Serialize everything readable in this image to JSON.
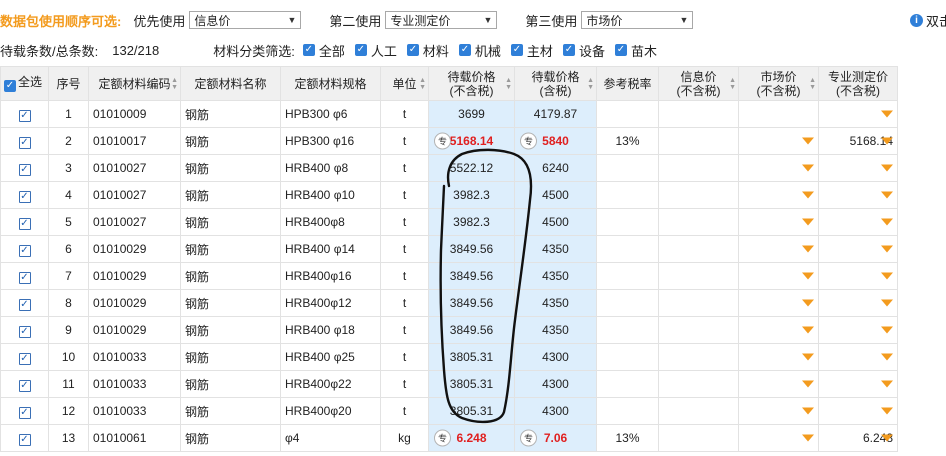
{
  "toolbar": {
    "title": "数据包使用顺序可选:",
    "first_label": "优先使用",
    "first_value": "信息价",
    "second_label": "第二使用",
    "second_value": "专业测定价",
    "third_label": "第三使用",
    "third_value": "市场价",
    "dual_label": "双击"
  },
  "filter": {
    "count_label": "待载条数/总条数:",
    "count_value": "132/218",
    "category_label": "材料分类筛选:",
    "items": [
      "全部",
      "人工",
      "材料",
      "机械",
      "主材",
      "设备",
      "苗木"
    ]
  },
  "columns": [
    {
      "l1": "全选",
      "l2": ""
    },
    {
      "l1": "序号",
      "l2": ""
    },
    {
      "l1": "定额材料编码",
      "l2": ""
    },
    {
      "l1": "定额材料名称",
      "l2": ""
    },
    {
      "l1": "定额材料规格",
      "l2": ""
    },
    {
      "l1": "单位",
      "l2": ""
    },
    {
      "l1": "待载价格",
      "l2": "(不含税)"
    },
    {
      "l1": "待载价格",
      "l2": "(含税)"
    },
    {
      "l1": "参考税率",
      "l2": ""
    },
    {
      "l1": "信息价",
      "l2": "(不含税)"
    },
    {
      "l1": "市场价",
      "l2": "(不含税)"
    },
    {
      "l1": "专业测定价",
      "l2": "(不含税)"
    }
  ],
  "tag_label": "专",
  "rows": [
    {
      "no": "1",
      "code": "01010009",
      "name": "钢筋",
      "spec": "HPB300 φ6",
      "unit": "t",
      "p1": "3699",
      "p2": "4179.87",
      "tax": "",
      "info": "",
      "market": "",
      "pro": "",
      "tagged": false,
      "hl": false,
      "info_dd": false,
      "market_dd": false
    },
    {
      "no": "2",
      "code": "01010017",
      "name": "钢筋",
      "spec": "HPB300 φ16",
      "unit": "t",
      "p1": "5168.14",
      "p2": "5840",
      "tax": "13%",
      "info": "",
      "market": "",
      "pro": "5168.14",
      "tagged": true,
      "hl": true,
      "info_dd": false,
      "market_dd": true
    },
    {
      "no": "3",
      "code": "01010027",
      "name": "钢筋",
      "spec": "HRB400 φ8",
      "unit": "t",
      "p1": "5522.12",
      "p2": "6240",
      "tax": "",
      "info": "",
      "market": "",
      "pro": "",
      "tagged": false,
      "hl": false,
      "info_dd": false,
      "market_dd": true
    },
    {
      "no": "4",
      "code": "01010027",
      "name": "钢筋",
      "spec": "HRB400 φ10",
      "unit": "t",
      "p1": "3982.3",
      "p2": "4500",
      "tax": "",
      "info": "",
      "market": "",
      "pro": "",
      "tagged": false,
      "hl": false,
      "info_dd": false,
      "market_dd": true
    },
    {
      "no": "5",
      "code": "01010027",
      "name": "钢筋",
      "spec": "HRB400φ8",
      "unit": "t",
      "p1": "3982.3",
      "p2": "4500",
      "tax": "",
      "info": "",
      "market": "",
      "pro": "",
      "tagged": false,
      "hl": false,
      "info_dd": false,
      "market_dd": true
    },
    {
      "no": "6",
      "code": "01010029",
      "name": "钢筋",
      "spec": "HRB400 φ14",
      "unit": "t",
      "p1": "3849.56",
      "p2": "4350",
      "tax": "",
      "info": "",
      "market": "",
      "pro": "",
      "tagged": false,
      "hl": false,
      "info_dd": false,
      "market_dd": true
    },
    {
      "no": "7",
      "code": "01010029",
      "name": "钢筋",
      "spec": "HRB400φ16",
      "unit": "t",
      "p1": "3849.56",
      "p2": "4350",
      "tax": "",
      "info": "",
      "market": "",
      "pro": "",
      "tagged": false,
      "hl": false,
      "info_dd": false,
      "market_dd": true
    },
    {
      "no": "8",
      "code": "01010029",
      "name": "钢筋",
      "spec": "HRB400φ12",
      "unit": "t",
      "p1": "3849.56",
      "p2": "4350",
      "tax": "",
      "info": "",
      "market": "",
      "pro": "",
      "tagged": false,
      "hl": false,
      "info_dd": false,
      "market_dd": true
    },
    {
      "no": "9",
      "code": "01010029",
      "name": "钢筋",
      "spec": "HRB400 φ18",
      "unit": "t",
      "p1": "3849.56",
      "p2": "4350",
      "tax": "",
      "info": "",
      "market": "",
      "pro": "",
      "tagged": false,
      "hl": false,
      "info_dd": false,
      "market_dd": true
    },
    {
      "no": "10",
      "code": "01010033",
      "name": "钢筋",
      "spec": "HRB400 φ25",
      "unit": "t",
      "p1": "3805.31",
      "p2": "4300",
      "tax": "",
      "info": "",
      "market": "",
      "pro": "",
      "tagged": false,
      "hl": false,
      "info_dd": false,
      "market_dd": true
    },
    {
      "no": "11",
      "code": "01010033",
      "name": "钢筋",
      "spec": "HRB400φ22",
      "unit": "t",
      "p1": "3805.31",
      "p2": "4300",
      "tax": "",
      "info": "",
      "market": "",
      "pro": "",
      "tagged": false,
      "hl": false,
      "info_dd": false,
      "market_dd": true
    },
    {
      "no": "12",
      "code": "01010033",
      "name": "钢筋",
      "spec": "HRB400φ20",
      "unit": "t",
      "p1": "3805.31",
      "p2": "4300",
      "tax": "",
      "info": "",
      "market": "",
      "pro": "",
      "tagged": false,
      "hl": false,
      "info_dd": false,
      "market_dd": true
    },
    {
      "no": "13",
      "code": "01010061",
      "name": "钢筋",
      "spec": "φ4",
      "unit": "kg",
      "p1": "6.248",
      "p2": "7.06",
      "tax": "13%",
      "info": "",
      "market": "",
      "pro": "6.248",
      "tagged": true,
      "hl": true,
      "info_dd": false,
      "market_dd": true
    }
  ],
  "colors": {
    "accent_orange": "#f39b1e",
    "checkbox_blue": "#2f7fd8",
    "price_bg": "#ddeefc",
    "highlight_red": "#e02020"
  }
}
